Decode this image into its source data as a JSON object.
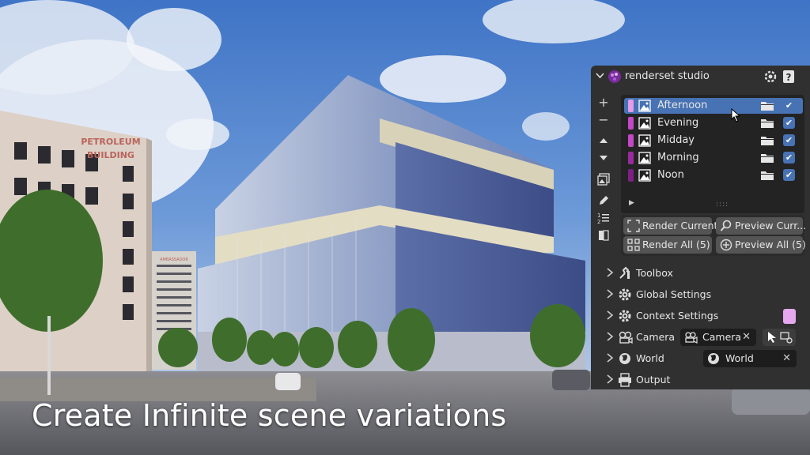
{
  "caption": "Create Infinite scene variations",
  "scene": {
    "sign_building": "PETROLEUM\nBUILDING",
    "sign_line1": "PETROLEUM",
    "sign_line2": "BUILDING",
    "sign_small": "AMBASSADOR"
  },
  "panel": {
    "title": "renderset studio",
    "contexts": [
      {
        "label": "Afternoon",
        "color": "#e59be6",
        "selected": true
      },
      {
        "label": "Evening",
        "color": "#c447c6",
        "selected": false
      },
      {
        "label": "Midday",
        "color": "#c447c6",
        "selected": false
      },
      {
        "label": "Morning",
        "color": "#9b2aa0",
        "selected": false
      },
      {
        "label": "Noon",
        "color": "#7e1f86",
        "selected": false
      }
    ],
    "buttons": {
      "render_current": "Render Current",
      "preview_current": "Preview Curr...",
      "render_all": "Render All (5)",
      "preview_all": "Preview All (5)"
    },
    "sections": {
      "toolbox": "Toolbox",
      "global_settings": "Global Settings",
      "context_settings": "Context Settings",
      "camera": "Camera",
      "world": "World",
      "output": "Output"
    },
    "camera_value": "Camera",
    "world_value": "World",
    "colors": {
      "panel_bg": "#303030",
      "list_bg": "#232323",
      "selection": "#4772b3",
      "context_color": "#e5a8ee"
    }
  }
}
